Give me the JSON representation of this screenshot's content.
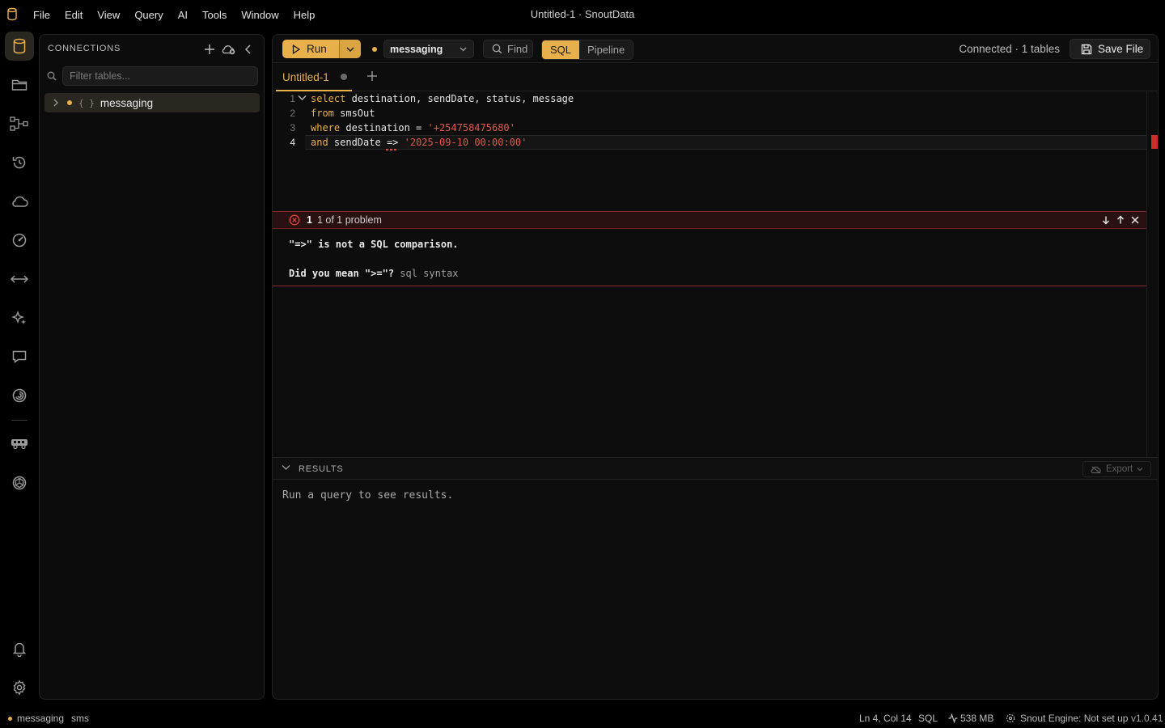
{
  "window": {
    "title": "Untitled-1 · SnoutData"
  },
  "menu": [
    "File",
    "Edit",
    "View",
    "Query",
    "AI",
    "Tools",
    "Window",
    "Help"
  ],
  "sidebar": {
    "header": "CONNECTIONS",
    "filter_placeholder": "Filter tables...",
    "tree": [
      {
        "label": "messaging",
        "type": "database",
        "connected": true
      }
    ]
  },
  "toolbar": {
    "run_label": "Run",
    "database": "messaging",
    "find_label": "Find",
    "modes": [
      "SQL",
      "Pipeline"
    ],
    "active_mode": "SQL",
    "status": "Connected · 1 tables",
    "save_label": "Save File"
  },
  "tabs": [
    {
      "label": "Untitled-1",
      "modified": true,
      "active": true
    }
  ],
  "editor": {
    "line_numbers": [
      "1",
      "2",
      "3",
      "4"
    ],
    "code": [
      [
        {
          "t": "select",
          "k": "kw"
        },
        {
          "t": " destination, sendDate, status, message",
          "k": "id"
        }
      ],
      [
        {
          "t": "from",
          "k": "kw"
        },
        {
          "t": " smsOut",
          "k": "id"
        }
      ],
      [
        {
          "t": "where",
          "k": "kw"
        },
        {
          "t": " destination = ",
          "k": "id"
        },
        {
          "t": "'+254758475680'",
          "k": "str"
        }
      ],
      [
        {
          "t": "and",
          "k": "kw"
        },
        {
          "t": " sendDate ",
          "k": "id"
        },
        {
          "t": "=>",
          "k": "err"
        },
        {
          "t": " ",
          "k": "id"
        },
        {
          "t": "'2025-09-10 00:00:00'",
          "k": "str"
        }
      ]
    ],
    "active_line": 4
  },
  "problem": {
    "count": "1",
    "summary": "1 of 1 problem",
    "message": "\"=>\" is not a SQL comparison.",
    "suggestion": "Did you mean \">=\"?",
    "source": "sql syntax"
  },
  "results": {
    "title": "RESULTS",
    "export_label": "Export",
    "empty_message": "Run a query to see results."
  },
  "statusbar": {
    "connection": "messaging",
    "schema": "sms",
    "position": "Ln 4, Col 14",
    "language": "SQL",
    "memory": "538 MB",
    "engine": "Snout Engine: Not set up",
    "version": "v1.0.41"
  },
  "colors": {
    "accent": "#e8b04a",
    "error": "#e0463c",
    "background": "#000000",
    "panel": "#0d0d0d"
  },
  "icons": {
    "activity_bar": [
      "database-icon",
      "folder-icon",
      "pipeline-icon",
      "history-icon",
      "cloud-icon",
      "gauge-icon",
      "transfer-icon",
      "sparkles-icon",
      "chat-icon",
      "swirl-icon",
      "truck-icon",
      "openai-icon",
      "bell-icon",
      "gear-icon"
    ]
  }
}
